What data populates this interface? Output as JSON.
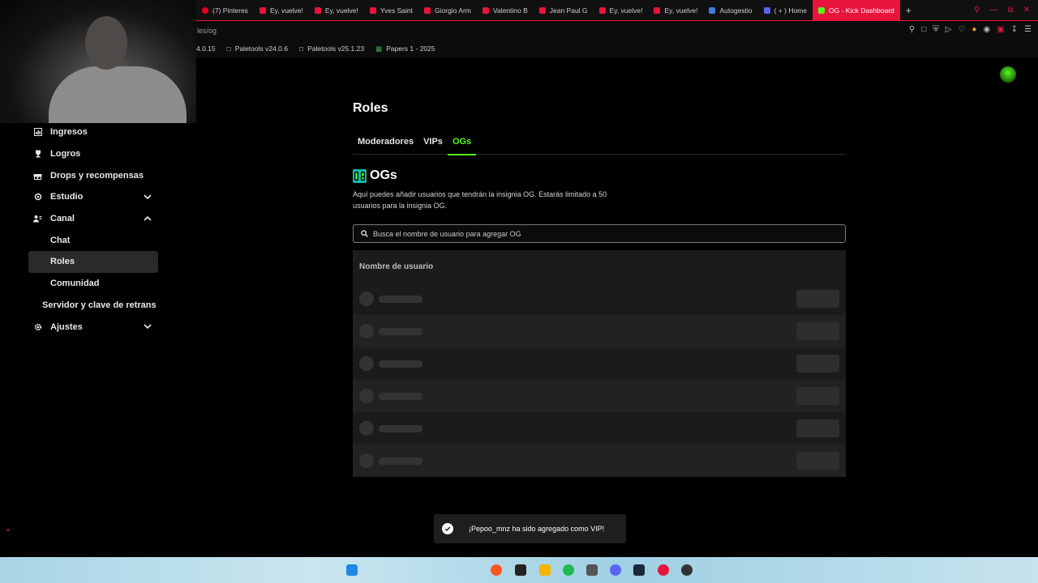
{
  "browser": {
    "tabs": [
      {
        "label": "(7) Pinteres",
        "color": "#e60023"
      },
      {
        "label": "Ey, vuelve!",
        "color": "#e8143c"
      },
      {
        "label": "Ey, vuelve!",
        "color": "#e8143c"
      },
      {
        "label": "Yves Saint",
        "color": "#e8143c"
      },
      {
        "label": "Giorgio Arm",
        "color": "#e8143c"
      },
      {
        "label": "Valentino B",
        "color": "#e8143c"
      },
      {
        "label": "Jean Paul G",
        "color": "#e8143c"
      },
      {
        "label": "Ey, vuelve!",
        "color": "#e8143c"
      },
      {
        "label": "Ey, vuelve!",
        "color": "#e8143c"
      },
      {
        "label": "Autogestio",
        "color": "#3b7dd8"
      },
      {
        "label": "( + ) Home",
        "color": "#5865f2"
      },
      {
        "label": "OG - Kick Dashboard",
        "color": "#53fc18"
      }
    ],
    "url_fragment": "les/og",
    "bookmarks": [
      {
        "label": "4.0.15"
      },
      {
        "label": "Paletools v24.0.6"
      },
      {
        "label": "Paletools v25.1.23"
      },
      {
        "label": "Papers 1 - 2025"
      }
    ]
  },
  "sidebar": {
    "items": [
      {
        "label": "Ingresos",
        "icon": "chart-icon"
      },
      {
        "label": "Logros",
        "icon": "trophy-icon"
      },
      {
        "label": "Drops y recompensas",
        "icon": "gift-icon"
      },
      {
        "label": "Estudio",
        "icon": "studio-icon"
      },
      {
        "label": "Canal",
        "icon": "channel-icon"
      },
      {
        "label": "Chat"
      },
      {
        "label": "Roles"
      },
      {
        "label": "Comunidad"
      },
      {
        "label": "Servidor y clave de retrans"
      },
      {
        "label": "Ajustes",
        "icon": "gear-icon"
      }
    ]
  },
  "main": {
    "title": "Roles",
    "tabs": [
      "Moderadores",
      "VIPs",
      "OGs"
    ],
    "section_title": "OGs",
    "description": "Aquí puedes añadir usuarios que tendrán la insignia OG. Estarás limitado a 50 usuarios para la insignia OG.",
    "search_placeholder": "Busca el nombre de usuario para agregar OG",
    "table_header": "Nombre de usuario"
  },
  "toast": {
    "message": "¡Pepoo_mnz ha sido agregado como VIP!"
  },
  "colors": {
    "accent": "#53fc18",
    "browser_accent": "#e8143c"
  }
}
